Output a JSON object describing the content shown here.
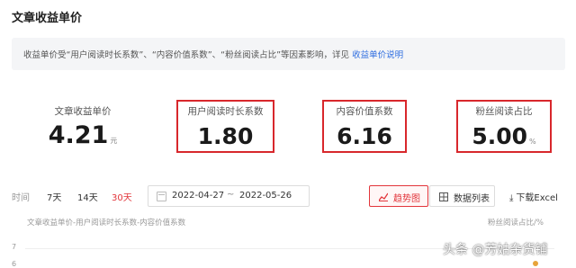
{
  "header": {
    "title": "文章收益单价"
  },
  "notice": {
    "text": "收益单价受“用户阅读时长系数”、“内容价值系数”、“粉丝阅读占比”等因素影响，详见",
    "link_text": "收益单价说明"
  },
  "metrics": [
    {
      "label": "文章收益单价",
      "value": "4.21",
      "unit": "元"
    },
    {
      "label": "用户阅读时长系数",
      "value": "1.80",
      "unit": ""
    },
    {
      "label": "内容价值系数",
      "value": "6.16",
      "unit": ""
    },
    {
      "label": "粉丝阅读占比",
      "value": "5.00",
      "unit": "%"
    }
  ],
  "highlight_color": "#d8272c",
  "filters": {
    "time_label": "时间",
    "ranges": [
      {
        "label": "7天",
        "active": false
      },
      {
        "label": "14天",
        "active": false
      },
      {
        "label": "30天",
        "active": true
      }
    ],
    "start_date": "2022-04-27",
    "separator": "~",
    "end_date": "2022-05-26",
    "trend_button": "趋势图",
    "list_button": "数据列表",
    "download": "下载Excel"
  },
  "chart": {
    "legend": "文章收益单价-用户阅读时长系数-内容价值系数",
    "right_axis_label": "粉丝阅读占比/%",
    "ticks": [
      "7",
      "6"
    ]
  },
  "watermark": "头条 @芳姑杂货铺"
}
